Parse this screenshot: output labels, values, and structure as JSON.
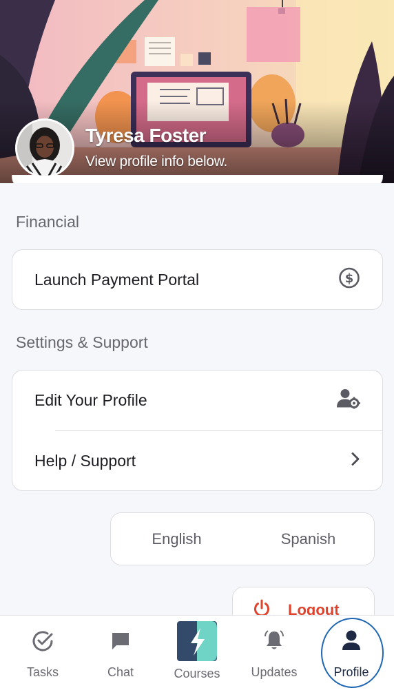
{
  "header": {
    "name": "Tyresa Foster",
    "subtitle": "View profile info below."
  },
  "financial": {
    "title": "Financial",
    "payment_portal": {
      "label": "Launch Payment Portal",
      "icon": "dollar-circle-icon"
    }
  },
  "settings": {
    "title": "Settings & Support",
    "items": [
      {
        "label": "Edit Your Profile",
        "icon": "user-gear-icon"
      },
      {
        "label": "Help / Support",
        "icon": "chevron-right-icon"
      }
    ]
  },
  "language": {
    "options": [
      "English",
      "Spanish"
    ]
  },
  "logout": {
    "label": "Logout",
    "icon": "power-icon",
    "color": "#e0432d"
  },
  "nav": {
    "items": [
      {
        "label": "Tasks",
        "icon": "check-circle-icon"
      },
      {
        "label": "Chat",
        "icon": "chat-bubble-icon"
      },
      {
        "label": "Courses",
        "icon": "bolt-logo-icon"
      },
      {
        "label": "Updates",
        "icon": "bell-icon"
      },
      {
        "label": "Profile",
        "icon": "person-icon",
        "selected": true
      }
    ],
    "accent": "#1f66b3"
  }
}
